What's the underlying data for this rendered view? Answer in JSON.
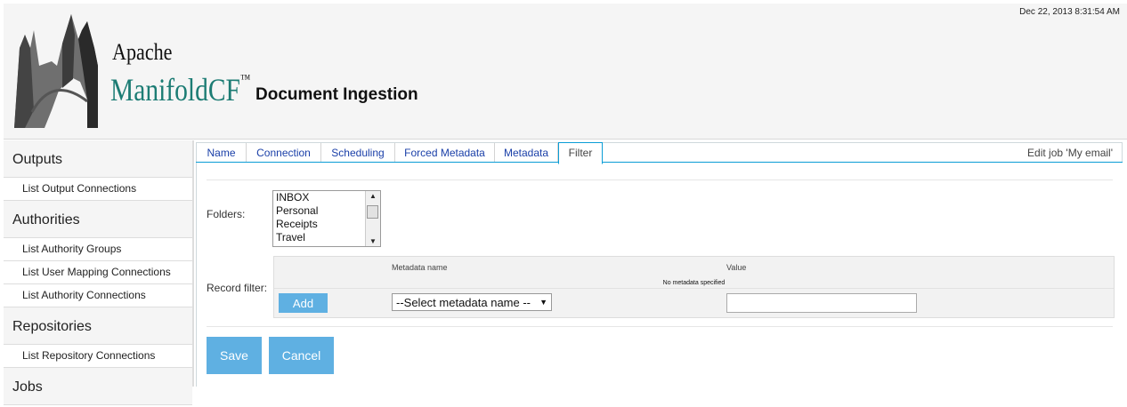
{
  "header": {
    "timestamp": "Dec 22, 2013 8:31:54 AM",
    "logo_apache": "Apache",
    "logo_name": "ManifoldCF",
    "logo_tm": "™",
    "page_title": "Document Ingestion"
  },
  "sidebar": {
    "sections": [
      {
        "title": "Outputs",
        "items": [
          "List Output Connections"
        ]
      },
      {
        "title": "Authorities",
        "items": [
          "List Authority Groups",
          "List User Mapping Connections",
          "List Authority Connections"
        ]
      },
      {
        "title": "Repositories",
        "items": [
          "List Repository Connections"
        ]
      },
      {
        "title": "Jobs",
        "items": []
      }
    ]
  },
  "tabs": {
    "items": [
      "Name",
      "Connection",
      "Scheduling",
      "Forced Metadata",
      "Metadata",
      "Filter"
    ],
    "active": "Filter",
    "edit_job_label": "Edit job 'My email'"
  },
  "form": {
    "folders_label": "Folders:",
    "folders": [
      "INBOX",
      "Personal",
      "Receipts",
      "Travel"
    ],
    "record_filter_label": "Record filter:",
    "metadata_name_header": "Metadata name",
    "value_header": "Value",
    "no_metadata_text": "No metadata specified",
    "add_button": "Add",
    "select_value": "--Select metadata name --",
    "value_input": "",
    "save_button": "Save",
    "cancel_button": "Cancel"
  },
  "colors": {
    "accent_teal": "#1c7c74",
    "tab_link": "#1a3fa8",
    "button_blue": "#5fb0e2",
    "tab_border_active": "#0a9dd6"
  },
  "icons": {
    "logo": "manifoldcf-logo-icon",
    "scroll_up": "chevron-up-icon",
    "scroll_down": "chevron-down-icon",
    "select_caret": "caret-down-icon"
  }
}
